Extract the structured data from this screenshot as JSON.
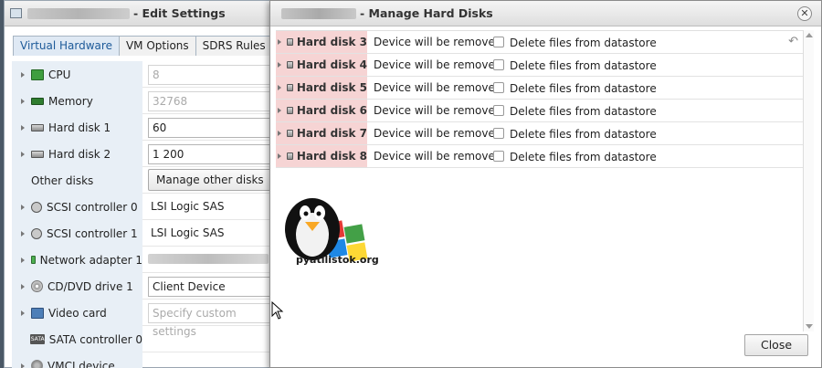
{
  "edit_settings": {
    "title": "- Edit Settings",
    "tabs": [
      "Virtual Hardware",
      "VM Options",
      "SDRS Rules"
    ],
    "rows": {
      "cpu": {
        "label": "CPU",
        "value": "8"
      },
      "memory": {
        "label": "Memory",
        "value": "32768"
      },
      "hard_disk_1": {
        "label": "Hard disk 1",
        "value": "60"
      },
      "hard_disk_2": {
        "label": "Hard disk 2",
        "value": "1 200"
      },
      "other_disks": {
        "label": "Other disks",
        "button": "Manage other disks"
      },
      "scsi_0": {
        "label": "SCSI controller 0",
        "value": "LSI Logic SAS"
      },
      "scsi_1": {
        "label": "SCSI controller 1",
        "value": "LSI Logic SAS"
      },
      "network": {
        "label": "Network adapter 1"
      },
      "cddvd": {
        "label": "CD/DVD drive 1",
        "value": "Client Device"
      },
      "video": {
        "label": "Video card",
        "placeholder": "Specify custom settings"
      },
      "sata": {
        "label": "SATA controller 0",
        "icon_text": "SATA"
      },
      "vmci": {
        "label": "VMCI device"
      }
    }
  },
  "dialog": {
    "title": "- Manage Hard Disks",
    "close_button": "Close",
    "disks": [
      {
        "name": "Hard disk 3",
        "status": "Device will be removed",
        "checkbox_label": "Delete files from datastore"
      },
      {
        "name": "Hard disk 4",
        "status": "Device will be removed",
        "checkbox_label": "Delete files from datastore"
      },
      {
        "name": "Hard disk 5",
        "status": "Device will be removed",
        "checkbox_label": "Delete files from datastore"
      },
      {
        "name": "Hard disk 6",
        "status": "Device will be removed",
        "checkbox_label": "Delete files from datastore"
      },
      {
        "name": "Hard disk 7",
        "status": "Device will be removed",
        "checkbox_label": "Delete files from datastore"
      },
      {
        "name": "Hard disk 8",
        "status": "Device will be removed",
        "checkbox_label": "Delete files from datastore"
      }
    ]
  },
  "logo": {
    "text": "pyatilistok.org"
  },
  "colors": {
    "removed_row_bg": "#f6d4d4",
    "label_column_bg": "#e8eff6",
    "active_tab_text": "#1d5a99",
    "background": "#6d7d8d"
  }
}
